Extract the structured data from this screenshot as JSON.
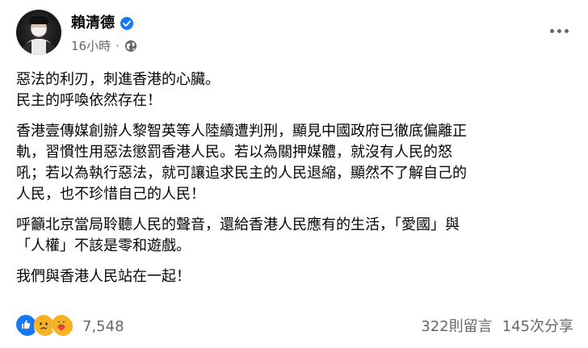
{
  "post": {
    "author": "賴清德",
    "time": "16小時",
    "separator": "·",
    "icons": {
      "verified": "verified-badge-icon",
      "audience": "globe-icon",
      "more": "more-options-icon"
    },
    "paragraphs": [
      [
        "惡法的利刃，刺進香港的心臟。",
        "民主的呼喚依然存在！"
      ],
      [
        "香港壹傳媒創辦人黎智英等人陸續遭判刑，顯見中國政府已徹底偏離正",
        "軌，習慣性用惡法懲罰香港人民。若以為關押媒體，就沒有人民的怒",
        "吼；若以為執行惡法，就可讓追求民主的人民退縮，顯然不了解自己的",
        "人民，也不珍惜自己的人民！"
      ],
      [
        "呼籲北京當局聆聽人民的聲音，還給香港人民應有的生活，「愛國」與",
        "「人權」不該是零和遊戲。"
      ],
      [
        "我們與香港人民站在一起！"
      ]
    ]
  },
  "footer": {
    "reaction_count": "7,548",
    "comments": "322則留言",
    "shares": "145次分享",
    "reaction_icons": [
      "like-icon",
      "sad-icon",
      "care-icon"
    ]
  },
  "colors": {
    "text": "#050505",
    "secondary": "#65676b",
    "facebook_blue": "#1877f2"
  }
}
